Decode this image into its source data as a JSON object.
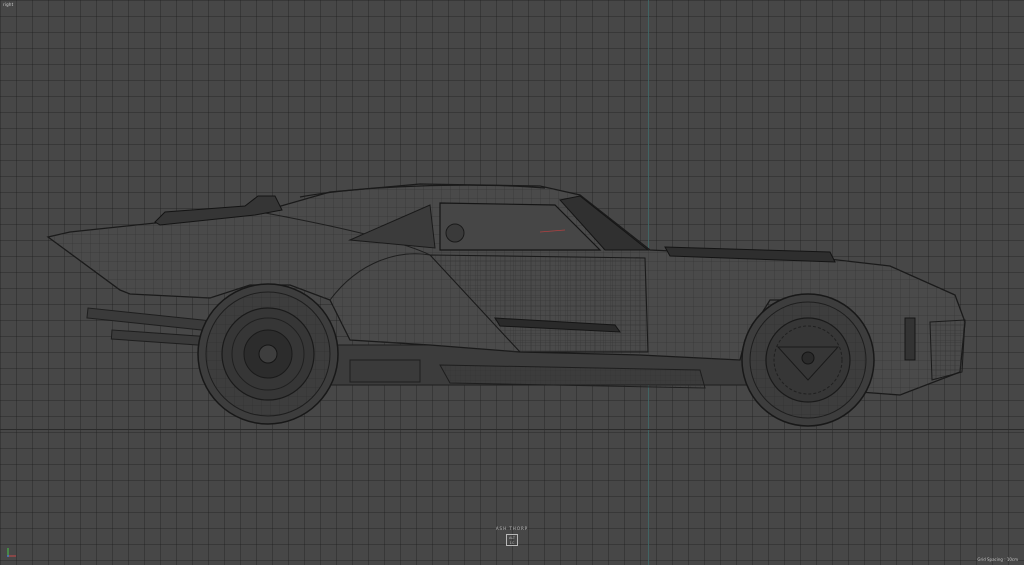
{
  "viewport": {
    "view_label": "right",
    "grid_spacing_label": "Grid Spacing : 10cm",
    "background_color": "#474747",
    "axis_color": "#3f6b6b"
  },
  "watermark": {
    "name": "ASH THORP",
    "badge_line1": "ALT",
    "badge_line2": "1C"
  },
  "icons": {
    "axis_gizmo": "axis-gizmo-icon"
  }
}
